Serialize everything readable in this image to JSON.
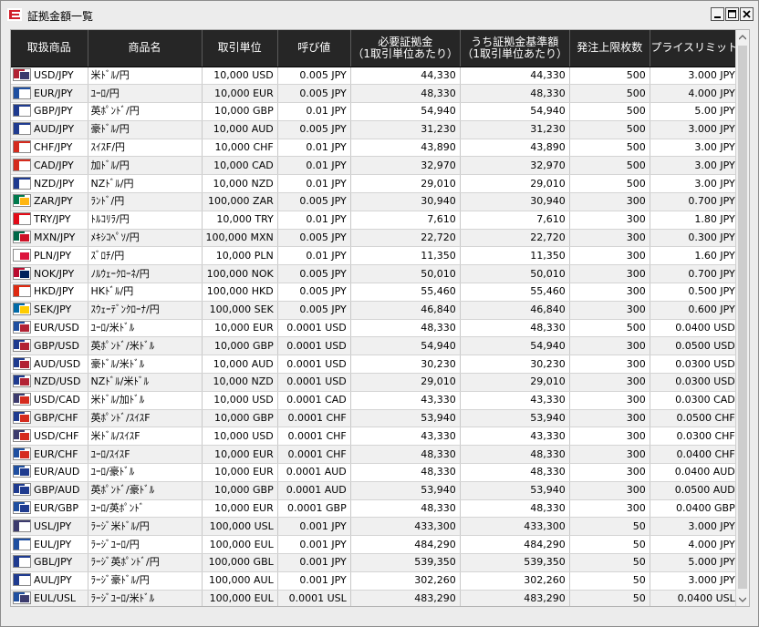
{
  "window": {
    "title": "証拠金額一覧"
  },
  "columns": [
    "取扱商品",
    "商品名",
    "取引単位",
    "呼び値",
    "必要証拠金\n（1取引単位あたり）",
    "うち証拠金基準額\n（1取引単位あたり）",
    "発注上限枚数",
    "プライスリミット"
  ],
  "rows": [
    {
      "symbol": "USD/JPY",
      "name": "米ﾄﾞﾙ/円",
      "unit": "10,000 USD",
      "tick": "0.005 JPY",
      "required": "44,330",
      "base": "44,330",
      "max_lots": "500",
      "price_limit": "3.000 JPY",
      "flag": [
        "#b22234",
        "#3c3b6e"
      ]
    },
    {
      "symbol": "EUR/JPY",
      "name": "ﾕｰﾛ/円",
      "unit": "10,000 EUR",
      "tick": "0.005 JPY",
      "required": "48,330",
      "base": "48,330",
      "max_lots": "500",
      "price_limit": "4.000 JPY",
      "flag": [
        "#1f4fa0",
        "#ffffff"
      ]
    },
    {
      "symbol": "GBP/JPY",
      "name": "英ﾎﾟﾝﾄﾞ/円",
      "unit": "10,000 GBP",
      "tick": "0.01 JPY",
      "required": "54,940",
      "base": "54,940",
      "max_lots": "500",
      "price_limit": "5.00 JPY",
      "flag": [
        "#1f3b8f",
        "#ffffff"
      ]
    },
    {
      "symbol": "AUD/JPY",
      "name": "豪ﾄﾞﾙ/円",
      "unit": "10,000 AUD",
      "tick": "0.005 JPY",
      "required": "31,230",
      "base": "31,230",
      "max_lots": "500",
      "price_limit": "3.000 JPY",
      "flag": [
        "#1f3b8f",
        "#ffffff"
      ]
    },
    {
      "symbol": "CHF/JPY",
      "name": "ｽｲｽF/円",
      "unit": "10,000 CHF",
      "tick": "0.01 JPY",
      "required": "43,890",
      "base": "43,890",
      "max_lots": "500",
      "price_limit": "3.00 JPY",
      "flag": [
        "#d52b1e",
        "#ffffff"
      ]
    },
    {
      "symbol": "CAD/JPY",
      "name": "加ﾄﾞﾙ/円",
      "unit": "10,000 CAD",
      "tick": "0.01 JPY",
      "required": "32,970",
      "base": "32,970",
      "max_lots": "500",
      "price_limit": "3.00 JPY",
      "flag": [
        "#d52b1e",
        "#ffffff"
      ]
    },
    {
      "symbol": "NZD/JPY",
      "name": "NZﾄﾞﾙ/円",
      "unit": "10,000 NZD",
      "tick": "0.01 JPY",
      "required": "29,010",
      "base": "29,010",
      "max_lots": "500",
      "price_limit": "3.00 JPY",
      "flag": [
        "#1f3b8f",
        "#ffffff"
      ]
    },
    {
      "symbol": "ZAR/JPY",
      "name": "ﾗﾝﾄﾞ/円",
      "unit": "100,000 ZAR",
      "tick": "0.005 JPY",
      "required": "30,940",
      "base": "30,940",
      "max_lots": "300",
      "price_limit": "0.700 JPY",
      "flag": [
        "#007a4d",
        "#ffb612"
      ]
    },
    {
      "symbol": "TRY/JPY",
      "name": "ﾄﾙｺﾘﾗ/円",
      "unit": "10,000 TRY",
      "tick": "0.01 JPY",
      "required": "7,610",
      "base": "7,610",
      "max_lots": "300",
      "price_limit": "1.80 JPY",
      "flag": [
        "#e30a17",
        "#ffffff"
      ]
    },
    {
      "symbol": "MXN/JPY",
      "name": "ﾒｷｼｺﾍﾟｿ/円",
      "unit": "100,000 MXN",
      "tick": "0.005 JPY",
      "required": "22,720",
      "base": "22,720",
      "max_lots": "300",
      "price_limit": "0.300 JPY",
      "flag": [
        "#006847",
        "#ce1126"
      ]
    },
    {
      "symbol": "PLN/JPY",
      "name": "ｽﾞﾛﾁ/円",
      "unit": "10,000 PLN",
      "tick": "0.01 JPY",
      "required": "11,350",
      "base": "11,350",
      "max_lots": "300",
      "price_limit": "1.60 JPY",
      "flag": [
        "#ffffff",
        "#dc143c"
      ]
    },
    {
      "symbol": "NOK/JPY",
      "name": "ﾉﾙｳｪｰｸﾛｰﾈ/円",
      "unit": "100,000 NOK",
      "tick": "0.005 JPY",
      "required": "50,010",
      "base": "50,010",
      "max_lots": "300",
      "price_limit": "0.700 JPY",
      "flag": [
        "#ba0c2f",
        "#00205b"
      ]
    },
    {
      "symbol": "HKD/JPY",
      "name": "HKﾄﾞﾙ/円",
      "unit": "100,000 HKD",
      "tick": "0.005 JPY",
      "required": "55,460",
      "base": "55,460",
      "max_lots": "300",
      "price_limit": "0.500 JPY",
      "flag": [
        "#de2910",
        "#ffffff"
      ]
    },
    {
      "symbol": "SEK/JPY",
      "name": "ｽｳｪｰﾃﾞﾝｸﾛｰﾅ/円",
      "unit": "100,000 SEK",
      "tick": "0.005 JPY",
      "required": "46,840",
      "base": "46,840",
      "max_lots": "300",
      "price_limit": "0.600 JPY",
      "flag": [
        "#006aa7",
        "#fecc00"
      ]
    },
    {
      "symbol": "EUR/USD",
      "name": "ﾕｰﾛ/米ﾄﾞﾙ",
      "unit": "10,000 EUR",
      "tick": "0.0001 USD",
      "required": "48,330",
      "base": "48,330",
      "max_lots": "500",
      "price_limit": "0.0400 USD",
      "flag": [
        "#1f4fa0",
        "#b22234"
      ]
    },
    {
      "symbol": "GBP/USD",
      "name": "英ﾎﾟﾝﾄﾞ/米ﾄﾞﾙ",
      "unit": "10,000 GBP",
      "tick": "0.0001 USD",
      "required": "54,940",
      "base": "54,940",
      "max_lots": "300",
      "price_limit": "0.0500 USD",
      "flag": [
        "#1f3b8f",
        "#b22234"
      ]
    },
    {
      "symbol": "AUD/USD",
      "name": "豪ﾄﾞﾙ/米ﾄﾞﾙ",
      "unit": "10,000 AUD",
      "tick": "0.0001 USD",
      "required": "30,230",
      "base": "30,230",
      "max_lots": "300",
      "price_limit": "0.0300 USD",
      "flag": [
        "#1f3b8f",
        "#b22234"
      ]
    },
    {
      "symbol": "NZD/USD",
      "name": "NZﾄﾞﾙ/米ﾄﾞﾙ",
      "unit": "10,000 NZD",
      "tick": "0.0001 USD",
      "required": "29,010",
      "base": "29,010",
      "max_lots": "300",
      "price_limit": "0.0300 USD",
      "flag": [
        "#1f3b8f",
        "#b22234"
      ]
    },
    {
      "symbol": "USD/CAD",
      "name": "米ﾄﾞﾙ/加ﾄﾞﾙ",
      "unit": "10,000 USD",
      "tick": "0.0001 CAD",
      "required": "43,330",
      "base": "43,330",
      "max_lots": "300",
      "price_limit": "0.0300 CAD",
      "flag": [
        "#3c3b6e",
        "#d52b1e"
      ]
    },
    {
      "symbol": "GBP/CHF",
      "name": "英ﾎﾟﾝﾄﾞ/ｽｲｽF",
      "unit": "10,000 GBP",
      "tick": "0.0001 CHF",
      "required": "53,940",
      "base": "53,940",
      "max_lots": "300",
      "price_limit": "0.0500 CHF",
      "flag": [
        "#1f3b8f",
        "#d52b1e"
      ]
    },
    {
      "symbol": "USD/CHF",
      "name": "米ﾄﾞﾙ/ｽｲｽF",
      "unit": "10,000 USD",
      "tick": "0.0001 CHF",
      "required": "43,330",
      "base": "43,330",
      "max_lots": "300",
      "price_limit": "0.0300 CHF",
      "flag": [
        "#3c3b6e",
        "#d52b1e"
      ]
    },
    {
      "symbol": "EUR/CHF",
      "name": "ﾕｰﾛ/ｽｲｽF",
      "unit": "10,000 EUR",
      "tick": "0.0001 CHF",
      "required": "48,330",
      "base": "48,330",
      "max_lots": "300",
      "price_limit": "0.0400 CHF",
      "flag": [
        "#1f4fa0",
        "#d52b1e"
      ]
    },
    {
      "symbol": "EUR/AUD",
      "name": "ﾕｰﾛ/豪ﾄﾞﾙ",
      "unit": "10,000 EUR",
      "tick": "0.0001 AUD",
      "required": "48,330",
      "base": "48,330",
      "max_lots": "300",
      "price_limit": "0.0400 AUD",
      "flag": [
        "#1f4fa0",
        "#1f3b8f"
      ]
    },
    {
      "symbol": "GBP/AUD",
      "name": "英ﾎﾟﾝﾄﾞ/豪ﾄﾞﾙ",
      "unit": "10,000 GBP",
      "tick": "0.0001 AUD",
      "required": "53,940",
      "base": "53,940",
      "max_lots": "300",
      "price_limit": "0.0500 AUD",
      "flag": [
        "#1f3b8f",
        "#1f3b8f"
      ]
    },
    {
      "symbol": "EUR/GBP",
      "name": "ﾕｰﾛ/英ﾎﾟﾝﾄﾞ",
      "unit": "10,000 EUR",
      "tick": "0.0001 GBP",
      "required": "48,330",
      "base": "48,330",
      "max_lots": "300",
      "price_limit": "0.0400 GBP",
      "flag": [
        "#1f4fa0",
        "#1f3b8f"
      ]
    },
    {
      "symbol": "USL/JPY",
      "name": "ﾗｰｼﾞ米ﾄﾞﾙ/円",
      "unit": "100,000 USL",
      "tick": "0.001 JPY",
      "required": "433,300",
      "base": "433,300",
      "max_lots": "50",
      "price_limit": "3.000 JPY",
      "flag": [
        "#3c3b6e",
        "#ffffff"
      ]
    },
    {
      "symbol": "EUL/JPY",
      "name": "ﾗｰｼﾞﾕｰﾛ/円",
      "unit": "100,000 EUL",
      "tick": "0.001 JPY",
      "required": "484,290",
      "base": "484,290",
      "max_lots": "50",
      "price_limit": "4.000 JPY",
      "flag": [
        "#1f4fa0",
        "#ffffff"
      ]
    },
    {
      "symbol": "GBL/JPY",
      "name": "ﾗｰｼﾞ英ﾎﾟﾝﾄﾞ/円",
      "unit": "100,000 GBL",
      "tick": "0.001 JPY",
      "required": "539,350",
      "base": "539,350",
      "max_lots": "50",
      "price_limit": "5.000 JPY",
      "flag": [
        "#1f3b8f",
        "#ffffff"
      ]
    },
    {
      "symbol": "AUL/JPY",
      "name": "ﾗｰｼﾞ豪ﾄﾞﾙ/円",
      "unit": "100,000 AUL",
      "tick": "0.001 JPY",
      "required": "302,260",
      "base": "302,260",
      "max_lots": "50",
      "price_limit": "3.000 JPY",
      "flag": [
        "#1f3b8f",
        "#ffffff"
      ]
    },
    {
      "symbol": "EUL/USL",
      "name": "ﾗｰｼﾞﾕｰﾛ/米ﾄﾞﾙ",
      "unit": "100,000 EUL",
      "tick": "0.0001 USL",
      "required": "483,290",
      "base": "483,290",
      "max_lots": "50",
      "price_limit": "0.0400 USL",
      "flag": [
        "#1f4fa0",
        "#3c3b6e"
      ]
    }
  ]
}
